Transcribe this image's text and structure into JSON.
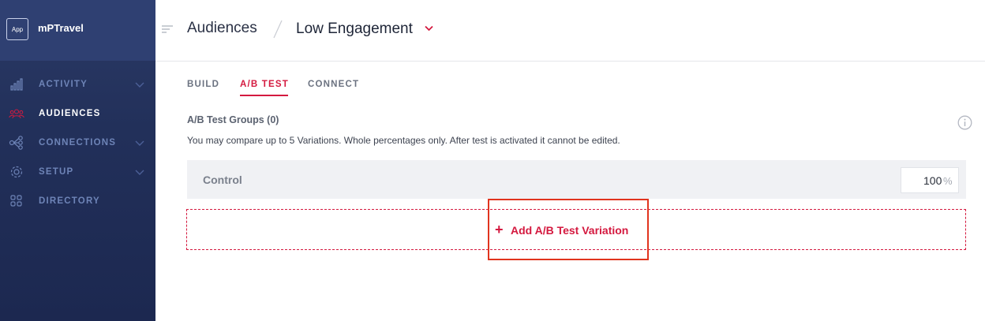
{
  "app": {
    "badge": "App",
    "name": "mPTravel"
  },
  "sidebar": {
    "items": [
      {
        "label": "ACTIVITY",
        "icon": "bar-chart-icon",
        "expandable": true,
        "active": false
      },
      {
        "label": "AUDIENCES",
        "icon": "people-icon",
        "expandable": false,
        "active": true
      },
      {
        "label": "CONNECTIONS",
        "icon": "network-icon",
        "expandable": true,
        "active": false
      },
      {
        "label": "SETUP",
        "icon": "gear-icon",
        "expandable": true,
        "active": false
      },
      {
        "label": "DIRECTORY",
        "icon": "grid-icon",
        "expandable": false,
        "active": false
      }
    ]
  },
  "header": {
    "breadcrumb_root": "Audiences",
    "breadcrumb_current": "Low Engagement"
  },
  "tabs": [
    {
      "label": "BUILD",
      "active": false
    },
    {
      "label": "A/B TEST",
      "active": true
    },
    {
      "label": "CONNECT",
      "active": false
    }
  ],
  "ab_test": {
    "title": "A/B Test Groups (0)",
    "description": "You may compare up to 5 Variations. Whole percentages only. After test is activated it cannot be edited.",
    "control": {
      "label": "Control",
      "value": "100",
      "unit": "%"
    },
    "add_plus": "+",
    "add_label": "Add A/B Test Variation"
  },
  "colors": {
    "accent": "#d4193f",
    "sidebar_bg": "#22305a",
    "highlight": "#e1341e"
  }
}
